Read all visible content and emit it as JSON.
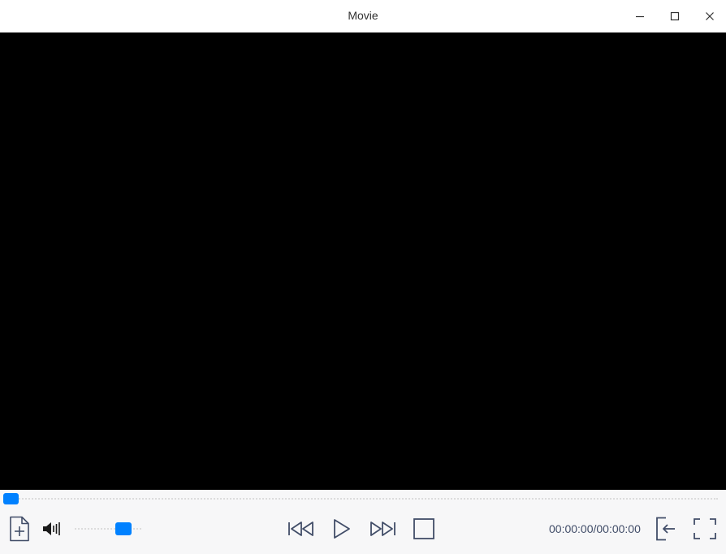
{
  "window": {
    "title": "Movie"
  },
  "playback": {
    "current_time": "00:00:00",
    "total_time": "00:00:00",
    "time_display": "00:00:00/00:00:00",
    "progress_fraction": 0.0,
    "volume_fraction": 0.8
  },
  "icons": {
    "minimize": "minimize-icon",
    "maximize": "maximize-icon",
    "close": "close-icon",
    "open_file": "add-file-icon",
    "volume": "volume-icon",
    "previous": "skip-previous-icon",
    "play": "play-icon",
    "next": "skip-next-icon",
    "stop": "stop-icon",
    "playlist": "playlist-icon",
    "fullscreen": "fullscreen-icon"
  },
  "colors": {
    "accent": "#0081ff",
    "icon": "#414d68",
    "video_bg": "#000000",
    "controls_bg": "#f7f7f8"
  }
}
